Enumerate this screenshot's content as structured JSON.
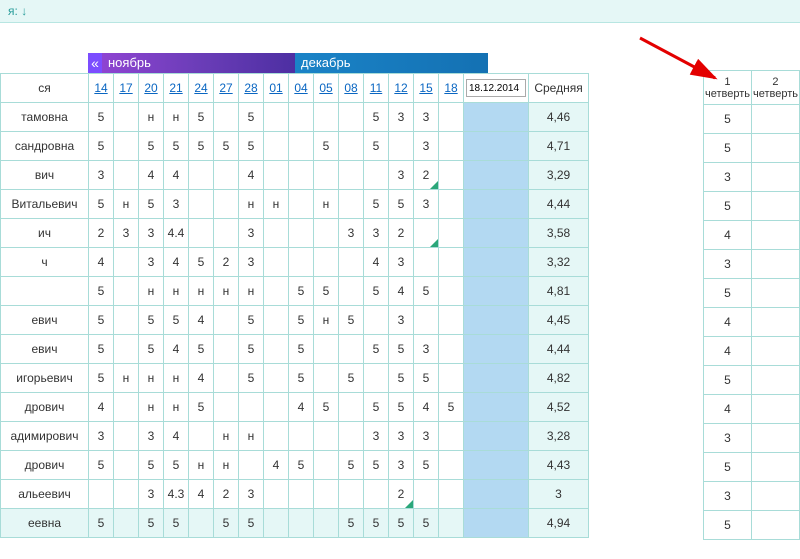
{
  "topbar": {
    "trailing": "я:",
    "download_icon": "↓"
  },
  "months": {
    "prev_glyph": "«",
    "nov": "ноябрь",
    "dec": "декабрь"
  },
  "name_header": "ся",
  "days": [
    "14",
    "17",
    "20",
    "21",
    "24",
    "27",
    "28",
    "01",
    "04",
    "05",
    "08",
    "11",
    "12",
    "15",
    "18"
  ],
  "date_value": "18.12.2014",
  "avg_header": "Средняя",
  "quarter_headers": {
    "q1_num": "1",
    "q1_lbl": "четверть",
    "q2_num": "2",
    "q2_lbl": "четверть"
  },
  "rows": [
    {
      "name": "тамовна",
      "g": [
        "5",
        "",
        "н",
        "н",
        "5",
        "",
        "5",
        "",
        "",
        "",
        "",
        "5",
        "3",
        "3",
        ""
      ],
      "avg": "4,46",
      "q1": "5"
    },
    {
      "name": "сандровна",
      "g": [
        "5",
        "",
        "5",
        "5",
        "5",
        "5",
        "5",
        "",
        "",
        "5",
        "",
        "5",
        "",
        "3",
        ""
      ],
      "avg": "4,71",
      "q1": "5"
    },
    {
      "name": "вич",
      "g": [
        "3",
        "",
        "4",
        "4",
        "",
        "",
        "4",
        "",
        "",
        "",
        "",
        "",
        "3",
        "2",
        ""
      ],
      "avg": "3,29",
      "q1": "3",
      "corner": [
        13
      ]
    },
    {
      "name": "Витальевич",
      "g": [
        "5",
        "н",
        "5",
        "3",
        "",
        "",
        "н",
        "н",
        "",
        "н",
        "",
        "5",
        "5",
        "3",
        ""
      ],
      "avg": "4,44",
      "q1": "5"
    },
    {
      "name": "ич",
      "g": [
        "2",
        "3",
        "3",
        "4.4",
        "",
        "",
        "3",
        "",
        "",
        "",
        "3",
        "3",
        "2",
        "",
        ""
      ],
      "avg": "3,58",
      "q1": "4",
      "corner": [
        13
      ]
    },
    {
      "name": "ч",
      "g": [
        "4",
        "",
        "3",
        "4",
        "5",
        "2",
        "3",
        "",
        "",
        "",
        "",
        "4",
        "3",
        "",
        ""
      ],
      "avg": "3,32",
      "q1": "3"
    },
    {
      "name": "",
      "g": [
        "5",
        "",
        "н",
        "н",
        "н",
        "н",
        "н",
        "",
        "5",
        "5",
        "",
        "5",
        "4",
        "5",
        ""
      ],
      "avg": "4,81",
      "q1": "5"
    },
    {
      "name": "евич",
      "g": [
        "5",
        "",
        "5",
        "5",
        "4",
        "",
        "5",
        "",
        "5",
        "н",
        "5",
        "",
        "3",
        "",
        ""
      ],
      "avg": "4,45",
      "q1": "4"
    },
    {
      "name": "евич",
      "g": [
        "5",
        "",
        "5",
        "4",
        "5",
        "",
        "5",
        "",
        "5",
        "",
        "",
        "5",
        "5",
        "3",
        ""
      ],
      "avg": "4,44",
      "q1": "4"
    },
    {
      "name": "игорьевич",
      "g": [
        "5",
        "н",
        "н",
        "н",
        "4",
        "",
        "5",
        "",
        "5",
        "",
        "5",
        "",
        "5",
        "5",
        ""
      ],
      "avg": "4,82",
      "q1": "5"
    },
    {
      "name": "дрович",
      "g": [
        "4",
        "",
        "н",
        "н",
        "5",
        "",
        "",
        "",
        "4",
        "5",
        "",
        "5",
        "5",
        "4",
        "5"
      ],
      "avg": "4,52",
      "q1": "4"
    },
    {
      "name": "адимирович",
      "g": [
        "3",
        "",
        "3",
        "4",
        "",
        "н",
        "н",
        "",
        "",
        "",
        "",
        "3",
        "3",
        "3",
        ""
      ],
      "avg": "3,28",
      "q1": "3"
    },
    {
      "name": "дрович",
      "g": [
        "5",
        "",
        "5",
        "5",
        "н",
        "н",
        "",
        "4",
        "5",
        "",
        "5",
        "5",
        "3",
        "5",
        ""
      ],
      "avg": "4,43",
      "q1": "5"
    },
    {
      "name": "альеевич",
      "g": [
        "",
        "",
        "3",
        "4.3",
        "4",
        "2",
        "3",
        "",
        "",
        "",
        "",
        "",
        "2",
        "",
        ""
      ],
      "avg": "3",
      "q1": "3",
      "corner": [
        12
      ]
    },
    {
      "name": "еевна",
      "g": [
        "5",
        "",
        "5",
        "5",
        "",
        "5",
        "5",
        "",
        "",
        "",
        "5",
        "5",
        "5",
        "5",
        ""
      ],
      "avg": "4,94",
      "q1": "5",
      "selected": true
    }
  ]
}
